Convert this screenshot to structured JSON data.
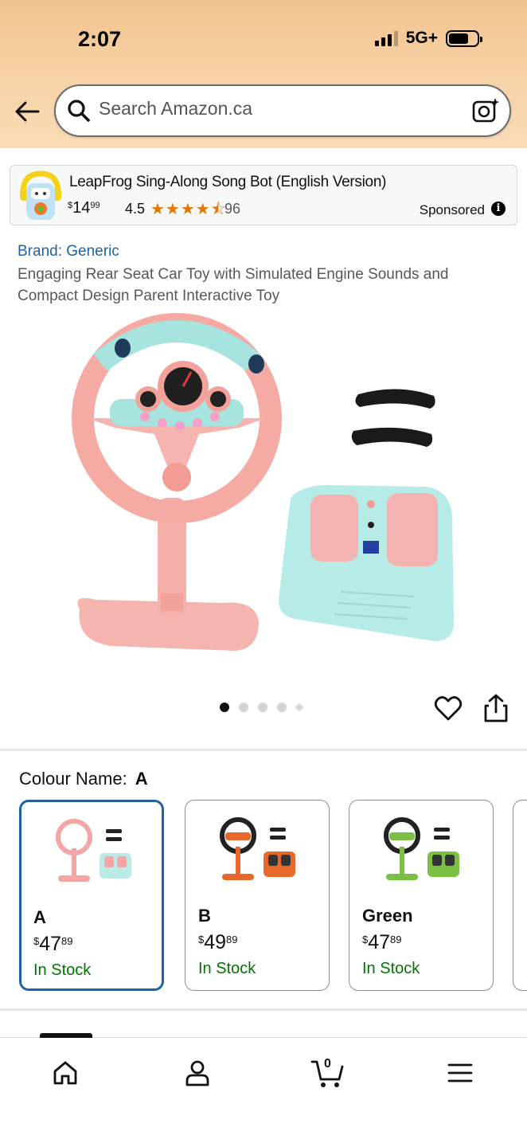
{
  "status_bar": {
    "time": "2:07",
    "network": "5G+"
  },
  "search": {
    "placeholder": "Search Amazon.ca"
  },
  "sponsored_ad": {
    "title": "LeapFrog Sing-Along Song Bot (English Version)",
    "price_symbol": "$",
    "price_whole": "14",
    "price_fraction": "99",
    "rating": "4.5",
    "stars": "★★★★⯪",
    "review_count": "96",
    "sponsored_label": "Sponsored",
    "info_glyph": "i"
  },
  "product": {
    "brand": "Brand: Generic",
    "title": "Engaging Rear Seat Car Toy with Simulated Engine Sounds and Compact Design Parent Interactive Toy",
    "image_count": 5,
    "active_image_index": 0
  },
  "colour": {
    "label": "Colour Name:",
    "selected": "A",
    "options": [
      {
        "name": "A",
        "price_symbol": "$",
        "price_whole": "47",
        "price_fraction": "89",
        "stock": "In Stock",
        "color": "#f4a6a6"
      },
      {
        "name": "B",
        "price_symbol": "$",
        "price_whole": "49",
        "price_fraction": "89",
        "stock": "In Stock",
        "color": "#e8672a"
      },
      {
        "name": "Green",
        "price_symbol": "$",
        "price_whole": "47",
        "price_fraction": "89",
        "stock": "In Stock",
        "color": "#7bc043"
      }
    ]
  },
  "bottom_nav": {
    "items": [
      "home-icon",
      "account-icon",
      "cart-icon",
      "menu-icon"
    ],
    "cart_count": "0"
  },
  "colors": {
    "accent_link": "#2162a1",
    "in_stock": "#007600",
    "star": "#e77600",
    "header_gradient": "#f2c38f"
  }
}
